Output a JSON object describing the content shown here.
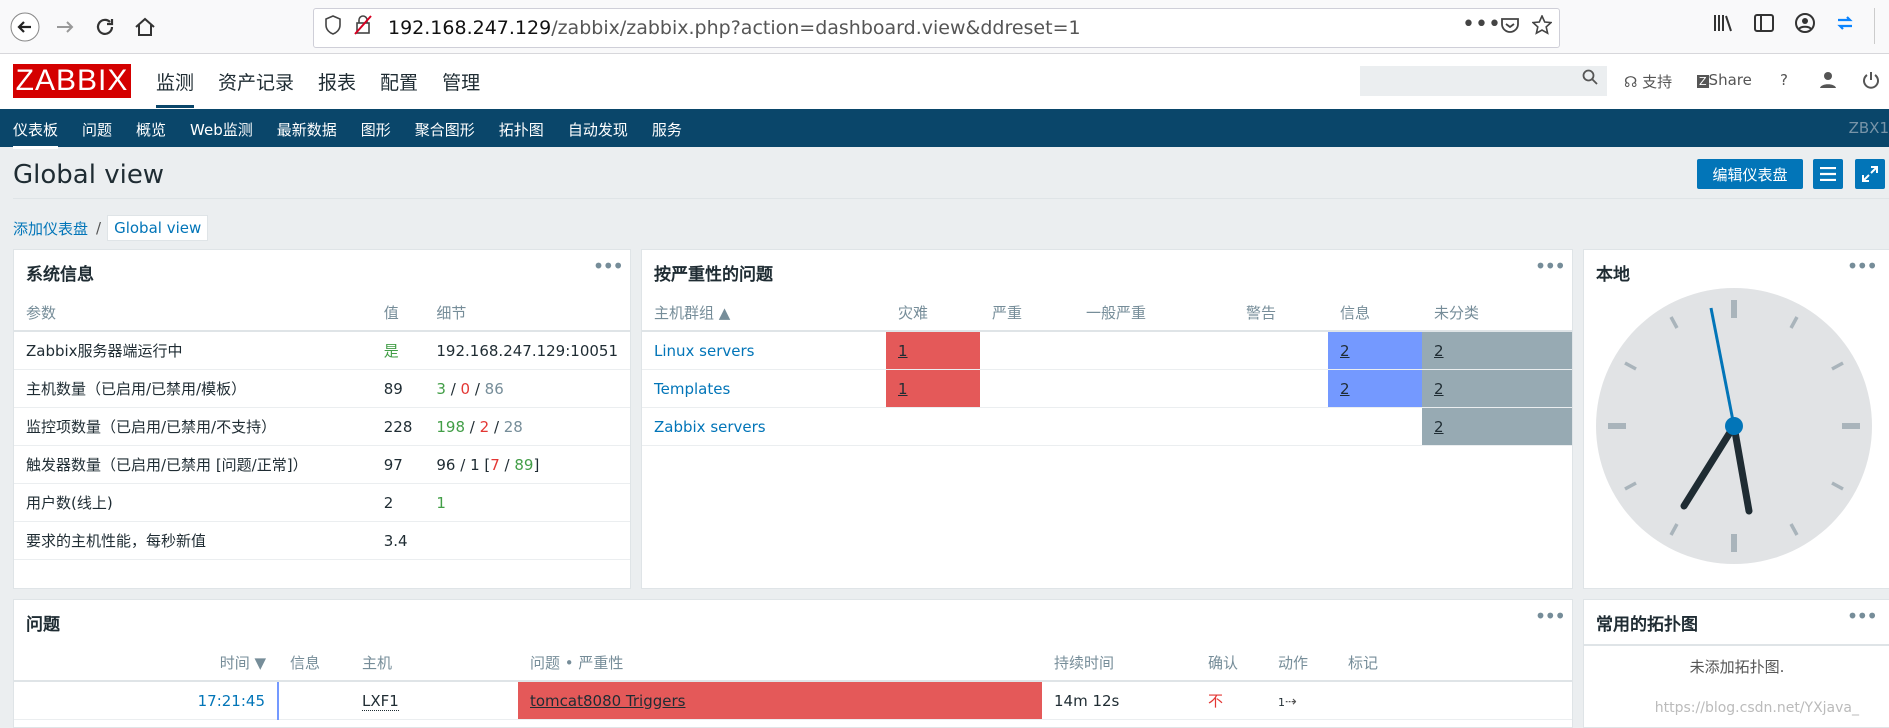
{
  "browser": {
    "url_host": "192.168.247.129",
    "url_path": "/zabbix/zabbix.php?action=dashboard.view&ddreset=1"
  },
  "header": {
    "logo": "ZABBIX",
    "menu": [
      "监测",
      "资产记录",
      "报表",
      "配置",
      "管理"
    ],
    "support": "支持",
    "share": "Share",
    "help": "?"
  },
  "submenu": {
    "items": [
      "仪表板",
      "问题",
      "概览",
      "Web监测",
      "最新数据",
      "图形",
      "聚合图形",
      "拓扑图",
      "自动发现",
      "服务"
    ],
    "right": "ZBX1"
  },
  "page": {
    "title": "Global view",
    "edit_button": "编辑仪表盘",
    "breadcrumb_parent": "添加仪表盘",
    "breadcrumb_sep": "/",
    "breadcrumb_current": "Global view"
  },
  "sysinfo": {
    "title": "系统信息",
    "headers": [
      "参数",
      "值",
      "细节"
    ],
    "rows": [
      {
        "param": "Zabbix服务器端运行中",
        "value": "是",
        "d1": "192.168.247.129:10051"
      },
      {
        "param": "主机数量（已启用/已禁用/模板）",
        "value": "89",
        "a": "3",
        "b": "0",
        "c": "86"
      },
      {
        "param": "监控项数量（已启用/已禁用/不支持）",
        "value": "228",
        "a": "198",
        "b": "2",
        "c": "28"
      },
      {
        "param": "触发器数量（已启用/已禁用 [问题/正常]）",
        "value": "97",
        "prefix": "96 / 1 [",
        "a": "7",
        "c": "89",
        "suffix": "]"
      },
      {
        "param": "用户数(线上)",
        "value": "2",
        "a": "1"
      },
      {
        "param": "要求的主机性能，每秒新值",
        "value": "3.4"
      }
    ]
  },
  "severity": {
    "title": "按严重性的问题",
    "headers": [
      "主机群组 ▲",
      "灾难",
      "严重",
      "一般严重",
      "警告",
      "信息",
      "未分类"
    ],
    "rows": [
      {
        "group": "Linux servers",
        "disaster": "1",
        "info": "2",
        "nc": "2"
      },
      {
        "group": "Templates",
        "disaster": "1",
        "info": "2",
        "nc": "2"
      },
      {
        "group": "Zabbix servers",
        "nc": "2"
      }
    ]
  },
  "clock": {
    "title": "本地"
  },
  "problems": {
    "title": "问题",
    "headers": [
      "时间 ▼",
      "信息",
      "主机",
      "问题 • 严重性",
      "持续时间",
      "确认",
      "动作",
      "标记"
    ],
    "row": {
      "time": "17:21:45",
      "host": "LXF1",
      "problem": "tomcat8080 Triggers",
      "duration": "14m 12s",
      "ack": "不",
      "actions": "1"
    }
  },
  "maps": {
    "title": "常用的拓扑图",
    "empty": "未添加拓扑图."
  },
  "watermark": "https://blog.csdn.net/YXjava_"
}
